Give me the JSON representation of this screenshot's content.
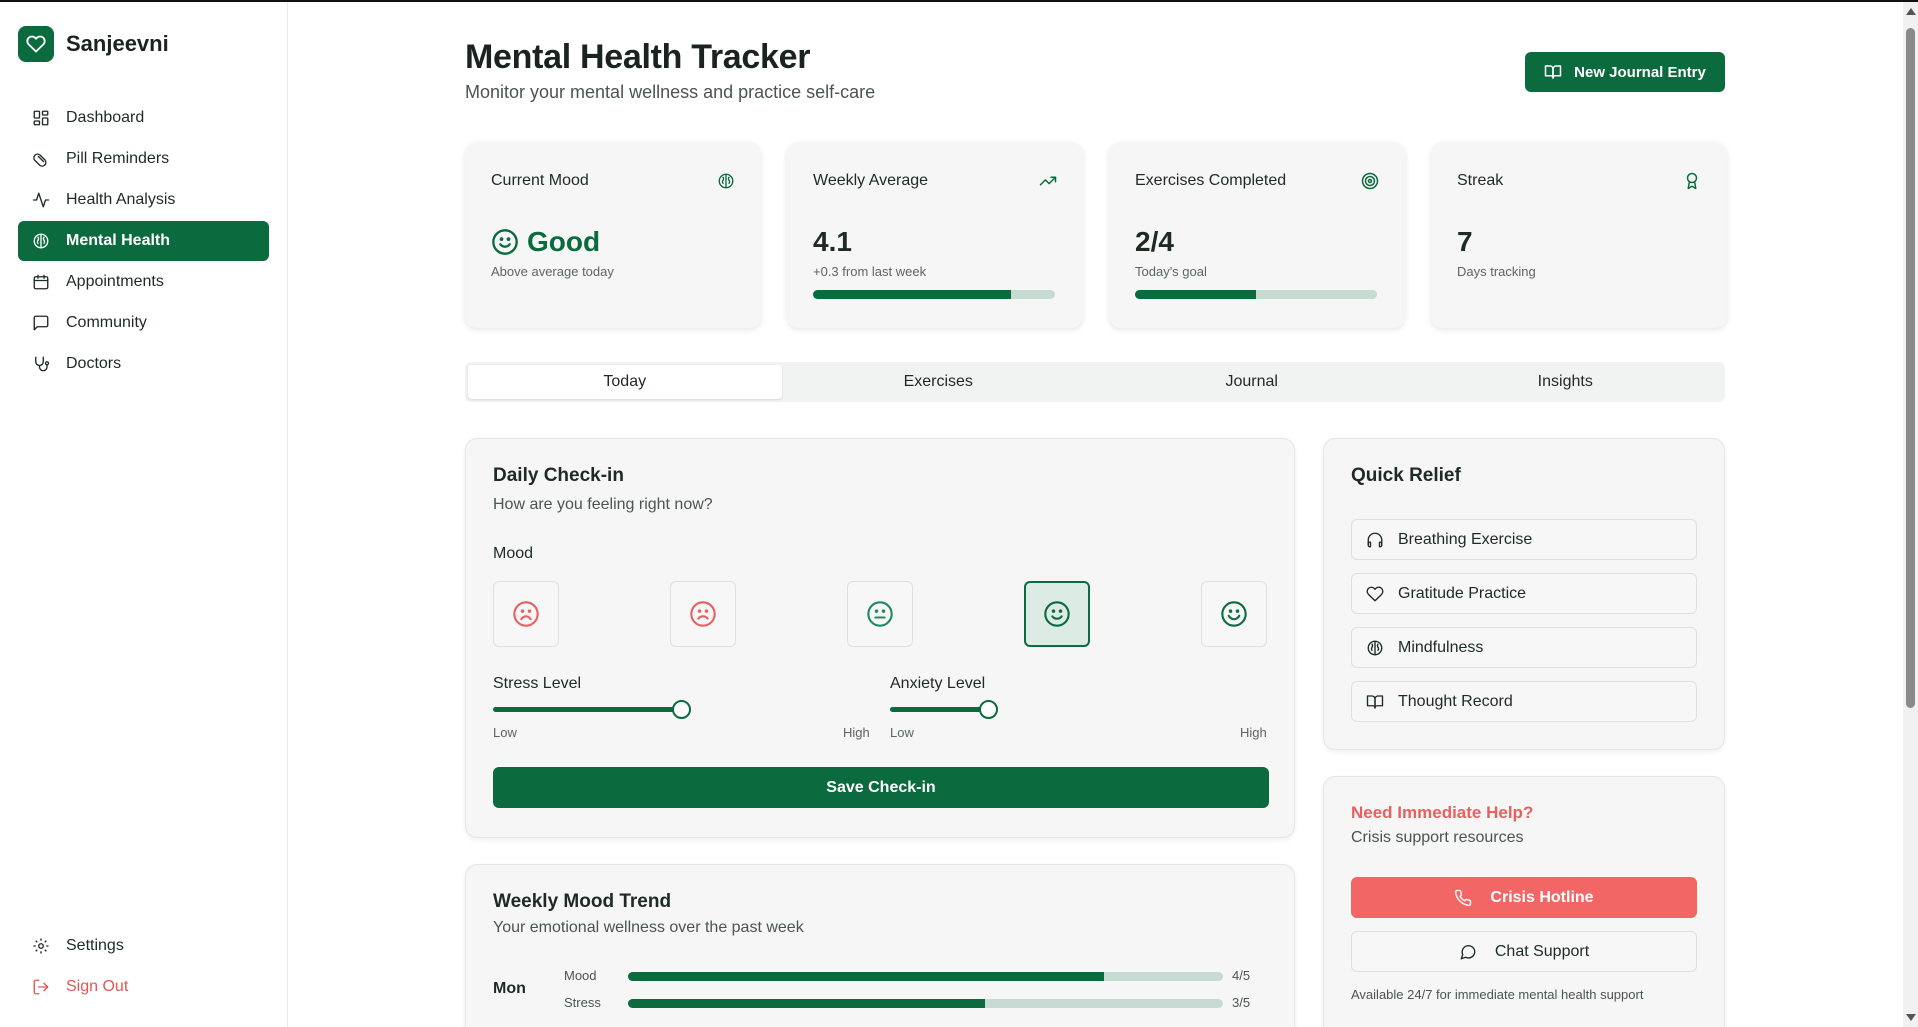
{
  "brand": {
    "name": "Sanjeevni",
    "logo_icon": "heart-icon",
    "accent": "#0b6b3f"
  },
  "sidebar": {
    "items": [
      {
        "label": "Dashboard",
        "icon": "grid-icon"
      },
      {
        "label": "Pill Reminders",
        "icon": "pill-icon"
      },
      {
        "label": "Health Analysis",
        "icon": "activity-icon"
      },
      {
        "label": "Mental Health",
        "icon": "brain-icon",
        "active": true
      },
      {
        "label": "Appointments",
        "icon": "calendar-icon"
      },
      {
        "label": "Community",
        "icon": "message-icon"
      },
      {
        "label": "Doctors",
        "icon": "stethoscope-icon"
      }
    ],
    "settings": "Settings",
    "sign_out": "Sign Out"
  },
  "header": {
    "title": "Mental Health Tracker",
    "subtitle": "Monitor your mental wellness and practice self-care",
    "new_entry": "New Journal Entry"
  },
  "stats": [
    {
      "label": "Current Mood",
      "value": "Good",
      "note": "Above average today",
      "icon": "brain-icon"
    },
    {
      "label": "Weekly Average",
      "value": "4.1",
      "note": "+0.3 from last week",
      "progress": 0.82,
      "icon": "trending-up-icon"
    },
    {
      "label": "Exercises Completed",
      "value": "2/4",
      "note": "Today's goal",
      "progress": 0.5,
      "icon": "target-icon"
    },
    {
      "label": "Streak",
      "value": "7",
      "note": "Days tracking",
      "icon": "award-icon"
    }
  ],
  "tabs": [
    "Today",
    "Exercises",
    "Journal",
    "Insights"
  ],
  "checkin": {
    "title": "Daily Check-in",
    "subtitle": "How are you feeling right now?",
    "mood_label": "Mood",
    "moods": [
      "very-sad-face-icon",
      "sad-face-icon",
      "neutral-face-icon",
      "happy-face-icon",
      "very-happy-face-icon"
    ],
    "selected_mood_index": 3,
    "stress": {
      "label": "Stress Level",
      "low": "Low",
      "high": "High",
      "value": 0.5
    },
    "anxiety": {
      "label": "Anxiety Level",
      "low": "Low",
      "high": "High",
      "value": 0.26
    },
    "save": "Save Check-in"
  },
  "trend": {
    "title": "Weekly Mood Trend",
    "subtitle": "Your emotional wellness over the past week",
    "rows": [
      {
        "day": "Mon",
        "metrics": [
          {
            "name": "Mood",
            "value": "4/5",
            "fraction": 0.8
          },
          {
            "name": "Stress",
            "value": "3/5",
            "fraction": 0.6
          }
        ]
      }
    ]
  },
  "relief": {
    "title": "Quick Relief",
    "items": [
      {
        "label": "Breathing Exercise",
        "icon": "headphones-icon"
      },
      {
        "label": "Gratitude Practice",
        "icon": "heart-icon"
      },
      {
        "label": "Mindfulness",
        "icon": "brain-icon"
      },
      {
        "label": "Thought Record",
        "icon": "book-icon"
      }
    ]
  },
  "help": {
    "title": "Need Immediate Help?",
    "subtitle": "Crisis support resources",
    "hotline": "Crisis Hotline",
    "chat": "Chat Support",
    "note": "Available 24/7 for immediate mental health support",
    "danger_color": "#f26666"
  }
}
